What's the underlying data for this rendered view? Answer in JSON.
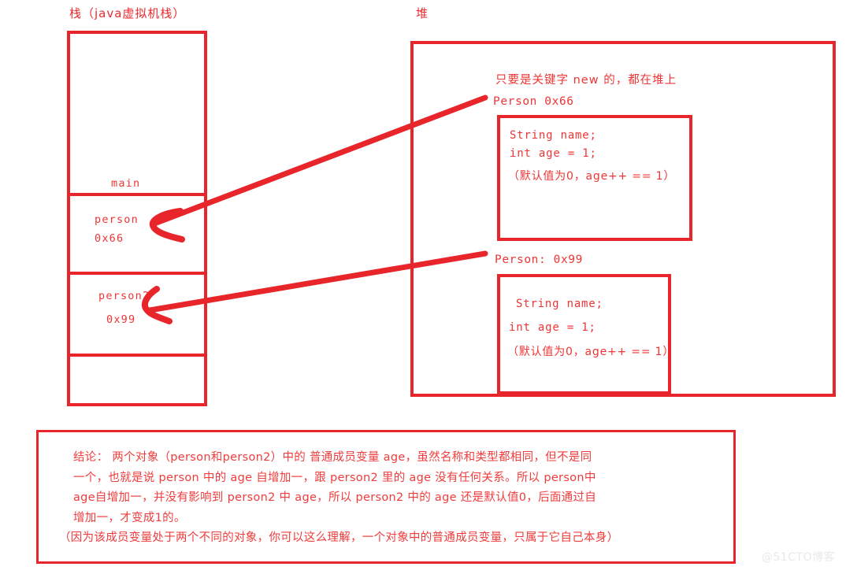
{
  "diagram": {
    "title_stack": "栈（java虚拟机栈）",
    "title_heap": "堆",
    "accent_color": "#e8252a",
    "text_color": "#ee3535"
  },
  "stack": {
    "frames": [
      {
        "name": "main-frame",
        "label": "main"
      },
      {
        "name": "person-frame",
        "label": "person",
        "value": "0x66"
      },
      {
        "name": "person2-frame",
        "label": "person2",
        "value": "0x99"
      },
      {
        "name": "empty-frame",
        "label": ""
      }
    ]
  },
  "heap": {
    "note": "只要是关键字 new 的，都在堆上",
    "objects": [
      {
        "label": "Person 0x66",
        "lines": [
          "String name;",
          "int age = 1;",
          "（默认值为0，age++ == 1）"
        ]
      },
      {
        "label": "Person: 0x99",
        "lines": [
          "String name;",
          "int age = 1;",
          "（默认值为0，age++ == 1）"
        ]
      }
    ]
  },
  "arrows": [
    {
      "name": "arrow-person-to-object1",
      "from": "Person 0x66",
      "to": "person 0x66"
    },
    {
      "name": "arrow-person2-to-object2",
      "from": "Person: 0x99",
      "to": "person2 0x99"
    }
  ],
  "conclusion": {
    "lines": [
      "结论： 两个对象（person和person2）中的 普通成员变量 age，虽然名称和类型都相同，但不是同",
      "一个，也就是说 person 中的 age 自增加一，跟 person2 里的 age 没有任何关系。所以 person中",
      "age自增加一，并没有影响到 person2 中 age，所以 person2 中的 age 还是默认值0，后面通过自",
      "增加一，才变成1的。",
      "（因为该成员变量处于两个不同的对象，你可以这么理解，一个对象中的普通成员变量，只属于它自己本身）"
    ]
  },
  "watermark": {
    "text": "@51CTO博客"
  }
}
